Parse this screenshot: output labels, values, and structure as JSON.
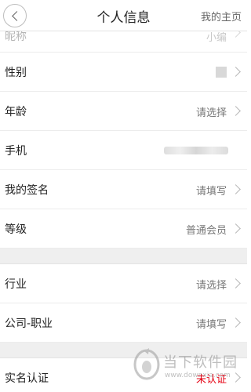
{
  "header": {
    "title": "个人信息",
    "right_link": "我的主页"
  },
  "rows": {
    "partial": {
      "label": "昵称",
      "value": "小编"
    },
    "gender": {
      "label": "性别"
    },
    "age": {
      "label": "年龄",
      "value": "请选择"
    },
    "phone": {
      "label": "手机"
    },
    "signature": {
      "label": "我的签名",
      "value": "请填写"
    },
    "level": {
      "label": "等级",
      "value": "普通会员"
    },
    "industry": {
      "label": "行业",
      "value": "请选择"
    },
    "company": {
      "label": "公司-职业",
      "value": "请填写"
    },
    "verification": {
      "label": "实名认证",
      "value": "未认证"
    }
  },
  "watermark": {
    "name": "当下软件园",
    "url": "www.downxia.com"
  },
  "colors": {
    "accent_red": "#e60012",
    "separator": "#efefef"
  }
}
